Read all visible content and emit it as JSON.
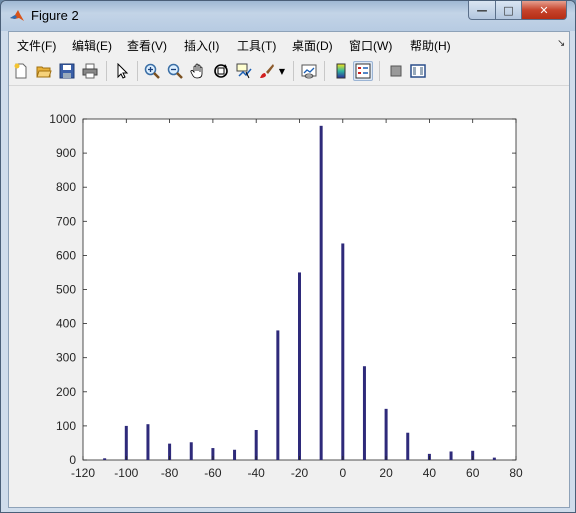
{
  "window": {
    "title": "Figure 2"
  },
  "menu": {
    "items": [
      {
        "label": "文件(F)",
        "name": "menu-file"
      },
      {
        "label": "编辑(E)",
        "name": "menu-edit"
      },
      {
        "label": "查看(V)",
        "name": "menu-view"
      },
      {
        "label": "插入(I)",
        "name": "menu-insert"
      },
      {
        "label": "工具(T)",
        "name": "menu-tools"
      },
      {
        "label": "桌面(D)",
        "name": "menu-desktop"
      },
      {
        "label": "窗口(W)",
        "name": "menu-window"
      },
      {
        "label": "帮助(H)",
        "name": "menu-help"
      }
    ]
  },
  "toolbar": {
    "icons": [
      "new-figure-icon",
      "open-file-icon",
      "save-icon",
      "print-icon",
      "pointer-icon",
      "zoom-in-icon",
      "zoom-out-icon",
      "pan-hand-icon",
      "rotate-3d-icon",
      "data-cursor-icon",
      "brush-icon",
      "brush-dropdown-icon",
      "link-plot-icon",
      "colorbar-icon",
      "legend-icon",
      "hide-plot-tools-icon",
      "show-plot-tools-icon"
    ]
  },
  "colors": {
    "bar": "#2e2a7a",
    "axes_bg": "#ffffff",
    "axes_line": "#262626"
  },
  "chart_data": {
    "type": "bar",
    "x": [
      -110,
      -100,
      -90,
      -80,
      -70,
      -60,
      -50,
      -40,
      -30,
      -20,
      -10,
      0,
      10,
      20,
      30,
      40,
      50,
      60,
      70
    ],
    "values": [
      5,
      100,
      105,
      48,
      52,
      35,
      30,
      88,
      380,
      550,
      980,
      635,
      275,
      150,
      80,
      18,
      25,
      27,
      7
    ],
    "xlim": [
      -120,
      80
    ],
    "ylim": [
      0,
      1000
    ],
    "xticks": [
      -120,
      -100,
      -80,
      -60,
      -40,
      -20,
      0,
      20,
      40,
      60,
      80
    ],
    "yticks": [
      0,
      100,
      200,
      300,
      400,
      500,
      600,
      700,
      800,
      900,
      1000
    ],
    "title": "",
    "xlabel": "",
    "ylabel": "",
    "grid": false
  }
}
